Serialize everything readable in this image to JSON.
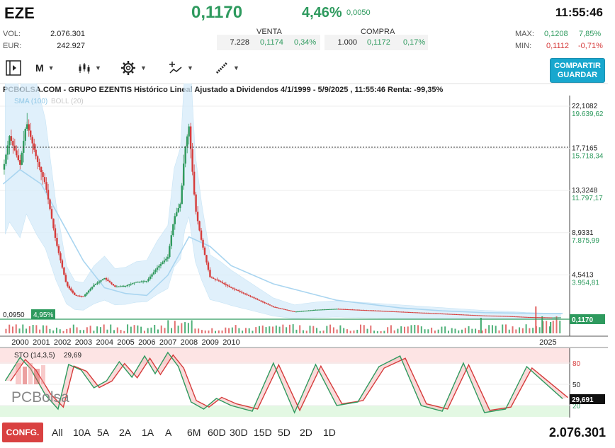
{
  "header": {
    "ticker": "EZE",
    "last": "0,1170",
    "pct_change": "4,46%",
    "abs_change": "0,0050",
    "time": "11:55:46",
    "vol_label": "VOL:",
    "vol_value": "2.076.301",
    "eur_label": "EUR:",
    "eur_value": "242.927",
    "venta": {
      "title": "VENTA",
      "qty": "7.228",
      "price": "0,1174",
      "pct": "0,34%"
    },
    "compra": {
      "title": "COMPRA",
      "qty": "1.000",
      "price": "0,1172",
      "pct": "0,17%"
    },
    "max_label": "MAX:",
    "max_value": "0,1208",
    "max_pct": "7,85%",
    "min_label": "MIN:",
    "min_value": "0,1112",
    "min_pct": "-0,71%"
  },
  "toolbar": {
    "period": "M",
    "share_line1": "COMPARTIR",
    "share_line2": "GUARDAR",
    "icons": [
      "panel-toggle-icon",
      "candles-icon",
      "gear-icon",
      "indicators-icon",
      "draw-icon"
    ]
  },
  "chart_meta": {
    "title": "PCBOLSA.COM - GRUPO EZENTIS Histórico Lineal Ajustado a Dividendos 4/1/1999 - 5/9/2025 , 11:55:46 Renta: -99,35%",
    "sma_label": "SMA (100)",
    "boll_label": "BOLL (20)",
    "left_price_tag": "0,0950",
    "left_pct_tag": "4,95%",
    "last_tag": "0,1170",
    "sto_label": "STO (14,3,5)",
    "sto_value": "29,69",
    "sto_tag": "29,691",
    "watermark": "PCBolsa"
  },
  "chart_data": [
    {
      "type": "line",
      "title": "PCBOLSA.COM - GRUPO EZENTIS Histórico Lineal Ajustado a Dividendos 4/1/1999 - 5/9/2025 , 11:55:46 Renta: -99,35%",
      "x_ticks": [
        "2000",
        "2001",
        "2002",
        "2003",
        "2004",
        "2005",
        "2006",
        "2007",
        "2008",
        "2009",
        "2010",
        "2025"
      ],
      "y_ticks_price": [
        "22,1082",
        "17,7165",
        "13,3248",
        "8,9331",
        "4,5413"
      ],
      "y_ticks_pct": [
        "19.639,62",
        "15.718,34",
        "11.797,17",
        "7.875,99",
        "3.954,81"
      ],
      "ylim": [
        0,
        22.1082
      ],
      "series": [
        {
          "name": "SMA (100)",
          "x": [
            1999.2,
            2000,
            2001,
            2002,
            2003,
            2004,
            2005,
            2006,
            2007,
            2008,
            2009,
            2010,
            2012,
            2015,
            2018,
            2020,
            2022,
            2025.7
          ],
          "values": [
            14,
            15.5,
            14,
            10,
            6,
            3.2,
            2.6,
            2.4,
            4.5,
            8.5,
            7.5,
            5.5,
            3.6,
            1.9,
            1.1,
            0.8,
            0.6,
            0.5
          ]
        },
        {
          "name": "Precio",
          "x": [
            1999.2,
            1999.5,
            2000.0,
            2000.3,
            2000.8,
            2001.2,
            2001.7,
            2002.2,
            2002.6,
            2003.0,
            2003.5,
            2004.0,
            2004.5,
            2005.0,
            2005.5,
            2006.0,
            2006.5,
            2007.0,
            2007.3,
            2007.6,
            2007.8,
            2008.0,
            2008.3,
            2008.6,
            2009.0,
            2009.5,
            2010.0,
            2011,
            2012,
            2013,
            2014,
            2015,
            2016,
            2017,
            2018,
            2019,
            2020,
            2021,
            2022,
            2023,
            2024,
            2025.2,
            2025.7
          ],
          "values": [
            15.5,
            19,
            16,
            20.5,
            16.5,
            14,
            8,
            3.5,
            2.4,
            2.3,
            3.5,
            4.2,
            3.3,
            3.4,
            3.8,
            3.9,
            5.3,
            6.4,
            10.5,
            12.0,
            17.5,
            20.0,
            11.5,
            8.0,
            4.3,
            3.8,
            3.2,
            2.2,
            1.2,
            0.7,
            0.9,
            1.0,
            0.9,
            0.8,
            0.7,
            0.6,
            0.5,
            0.4,
            0.3,
            0.25,
            0.15,
            0.1,
            0.117
          ]
        }
      ]
    },
    {
      "type": "line",
      "title": "STO (14,3,5)",
      "y_ticks": [
        "80",
        "50",
        "20"
      ],
      "ylim": [
        0,
        100
      ],
      "series": [
        {
          "name": "STO (14,3,5)",
          "x": [
            1999.3,
            2000.0,
            2000.5,
            2001.2,
            2001.8,
            2002.3,
            2002.9,
            2003.5,
            2004.1,
            2004.7,
            2005.3,
            2005.9,
            2006.4,
            2007.0,
            2007.5,
            2008.1,
            2008.7,
            2009.3,
            2010.0,
            2011,
            2012,
            2013,
            2014,
            2015,
            2016,
            2017,
            2018,
            2019,
            2020,
            2021,
            2022,
            2023,
            2024,
            2025.7
          ],
          "values": [
            55,
            88,
            72,
            35,
            15,
            78,
            70,
            45,
            55,
            82,
            60,
            90,
            65,
            95,
            75,
            25,
            15,
            30,
            20,
            12,
            80,
            10,
            78,
            20,
            25,
            75,
            90,
            20,
            12,
            80,
            10,
            15,
            75,
            29.69
          ]
        }
      ]
    }
  ],
  "ranges": [
    "All",
    "10A",
    "5A",
    "2A",
    "1A",
    "A",
    "6M",
    "60D",
    "30D",
    "15D",
    "5D",
    "2D",
    "1D"
  ],
  "footer": {
    "config": "CONFG.",
    "volume": "2.076.301"
  }
}
